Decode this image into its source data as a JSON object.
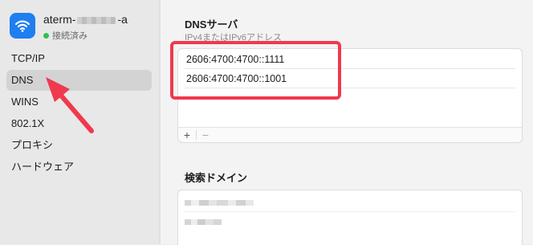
{
  "network": {
    "name_prefix": "aterm-",
    "name_suffix": "-a",
    "status": "接続済み",
    "status_color": "#31c14b",
    "icon": "wifi-icon",
    "icon_bg": "#1f7ef0"
  },
  "sidebar": {
    "items": [
      {
        "label": "TCP/IP",
        "selected": false
      },
      {
        "label": "DNS",
        "selected": true
      },
      {
        "label": "WINS",
        "selected": false
      },
      {
        "label": "802.1X",
        "selected": false
      },
      {
        "label": "プロキシ",
        "selected": false
      },
      {
        "label": "ハードウェア",
        "selected": false
      }
    ]
  },
  "dns_servers": {
    "title": "DNSサーバ",
    "subtitle": "IPv4またはIPv6アドレス",
    "entries": [
      "2606:4700:4700::1111",
      "2606:4700:4700::1001"
    ],
    "add_label": "+",
    "remove_label": "−"
  },
  "search_domains": {
    "title": "検索ドメイン"
  },
  "annotation": {
    "highlight_color": "#f0394d",
    "arrow_color": "#f0394d"
  }
}
